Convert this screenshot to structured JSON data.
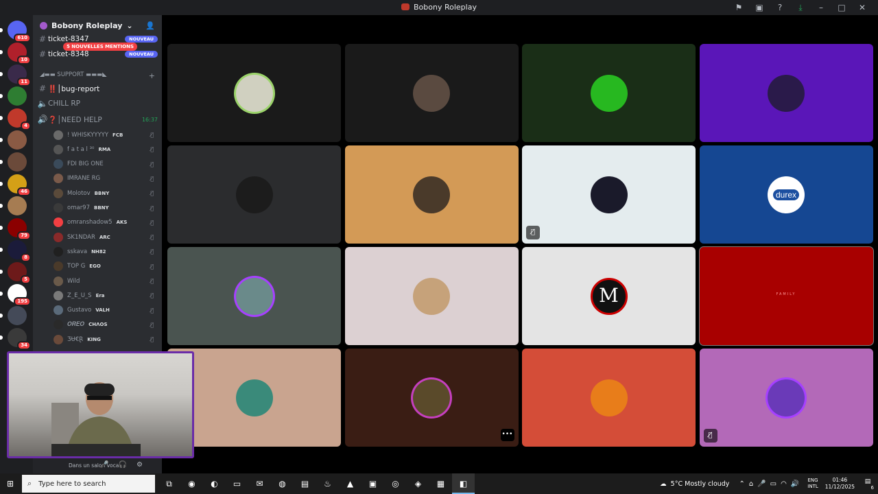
{
  "window": {
    "title": "Bobony Roleplay",
    "icons": [
      "flag-icon",
      "window-icon",
      "help-icon",
      "download-icon"
    ]
  },
  "servers": [
    {
      "name": "discord-home",
      "badge": "610",
      "color": "#5865f2"
    },
    {
      "name": "server-1",
      "badge": "10",
      "color": "#b0202b"
    },
    {
      "name": "server-2",
      "badge": "11",
      "color": "#3a2a4a"
    },
    {
      "name": "server-3",
      "badge": "",
      "color": "#2e7d32"
    },
    {
      "name": "server-4",
      "badge": "4",
      "color": "#c0392b"
    },
    {
      "name": "server-5",
      "badge": "",
      "color": "#8a5a44"
    },
    {
      "name": "server-6",
      "badge": "",
      "color": "#6b4a3a"
    },
    {
      "name": "server-7",
      "badge": "46",
      "color": "#d4a017"
    },
    {
      "name": "server-8",
      "badge": "",
      "color": "#a67c52"
    },
    {
      "name": "server-9",
      "badge": "79",
      "color": "#8b0000"
    },
    {
      "name": "server-10",
      "badge": "8",
      "color": "#1b1b3a"
    },
    {
      "name": "server-11",
      "badge": "5",
      "color": "#6d1a1a"
    },
    {
      "name": "server-12",
      "badge": "195",
      "color": "#ffffff"
    },
    {
      "name": "server-13",
      "badge": "",
      "color": "#444a58"
    },
    {
      "name": "server-14",
      "badge": "34",
      "color": "#3a3a3a"
    }
  ],
  "sidebar": {
    "guild": "Bobony Roleplay",
    "mentions": "5 NOUVELLES MENTIONS",
    "tickets": [
      {
        "name": "ticket-8347",
        "badge": "NOUVEAU"
      },
      {
        "name": "ticket-8348",
        "badge": "NOUVEAU"
      }
    ],
    "category": "◢▬▬ SUPPORT ▬▬▬◣",
    "channels": [
      {
        "name": "‼️│bug-report",
        "type": "text"
      },
      {
        "name": "CHILL RP",
        "type": "voice"
      },
      {
        "name": "❓│NEED HELP",
        "type": "voice",
        "time": "16:37"
      }
    ],
    "voice_users": [
      {
        "name": "! WHISKYYYYY",
        "tag": "FCB",
        "color": "#6a6a6a"
      },
      {
        "name": "f a t a l ³⁰",
        "tag": "RMA",
        "color": "#555555"
      },
      {
        "name": "FDI BIG ONE",
        "tag": "",
        "color": "#3a4a5a"
      },
      {
        "name": "IMRANE RG",
        "tag": "",
        "color": "#7a5a4a"
      },
      {
        "name": "Molotov",
        "tag": "BBNY",
        "color": "#5a4a3a"
      },
      {
        "name": "omar97",
        "tag": "BBNY",
        "color": "#3a3a3a"
      },
      {
        "name": "omranshadow5",
        "tag": "AKS",
        "color": "#f23f42"
      },
      {
        "name": "SK1NDAR",
        "tag": "ARC",
        "color": "#8a2a2a"
      },
      {
        "name": "sskava",
        "tag": "NH82",
        "color": "#202020"
      },
      {
        "name": "TOP G",
        "tag": "EGO",
        "color": "#4a3a2a"
      },
      {
        "name": "Wild",
        "tag": "",
        "color": "#6a5a4a"
      },
      {
        "name": "Z_E_U_S",
        "tag": "Era",
        "color": "#7a7a7a"
      },
      {
        "name": "Gustavo",
        "tag": "VALH",
        "color": "#5a6a7a"
      },
      {
        "name": "𝑶𝑹𝑬𝑶",
        "tag": "CHΛOS",
        "color": "#2a2a2a"
      },
      {
        "name": "ƷɄ€Ɽ",
        "tag": "KING",
        "color": "#6a4a3a"
      }
    ],
    "voice_status": "Dans un salon vocal"
  },
  "tiles": [
    {
      "bg": "#1a1a1a",
      "avatar": "#d0d0c0",
      "ring": "#9bd36a"
    },
    {
      "bg": "#1a1a1a",
      "avatar": "#5a4a40",
      "ring": ""
    },
    {
      "bg": "#1a2e17",
      "avatar": "#27b820",
      "ring": ""
    },
    {
      "bg": "#5a16b8",
      "avatar": "#2a1a4a",
      "ring": ""
    },
    {
      "bg": "#2b2c2e",
      "avatar": "#1c1c1c",
      "ring": ""
    },
    {
      "bg": "#d39a56",
      "avatar": "#4a3a2a",
      "ring": ""
    },
    {
      "bg": "#e4ecee",
      "avatar": "#1a1a2a",
      "ring": "",
      "muted": true
    },
    {
      "bg": "#154792",
      "avatar": "durex",
      "ring": ""
    },
    {
      "bg": "#4a5450",
      "avatar": "#6a8a8a",
      "ring": "#a640ff"
    },
    {
      "bg": "#dcd0d2",
      "avatar": "#c6a27a",
      "ring": ""
    },
    {
      "bg": "#e4e4e4",
      "avatar": "M",
      "ring": ""
    },
    {
      "bg": "#a80000",
      "avatar": "family",
      "ring": "",
      "bordered": true
    },
    {
      "bg": "#c9a48f",
      "avatar": "#3a8a7a",
      "ring": ""
    },
    {
      "bg": "#3a1d14",
      "avatar": "#5a4a2a",
      "ring": "#c53fbf",
      "more": true
    },
    {
      "bg": "#d44d38",
      "avatar": "#e87d1a",
      "ring": ""
    },
    {
      "bg": "#b369b8",
      "avatar": "#6a3ab8",
      "ring": "#a640ff",
      "muted": true
    }
  ],
  "durex_label": "durex",
  "family_label": "FAMILY",
  "m_label": "M",
  "taskbar": {
    "search_placeholder": "Type here to search",
    "apps": [
      "task-view-icon",
      "chrome-icon",
      "edge-icon",
      "explorer-icon",
      "outlook-icon",
      "firefox-icon",
      "notes-icon",
      "steam-icon",
      "app-a-icon",
      "window-app-icon",
      "obs-icon",
      "rockstar-icon",
      "app-icon",
      "discord-icon"
    ],
    "weather": "5°C  Mostly cloudy",
    "lang_1": "ENG",
    "lang_2": "INTL",
    "time": "01:46",
    "date": "11/12/2025",
    "notifications": "6"
  }
}
